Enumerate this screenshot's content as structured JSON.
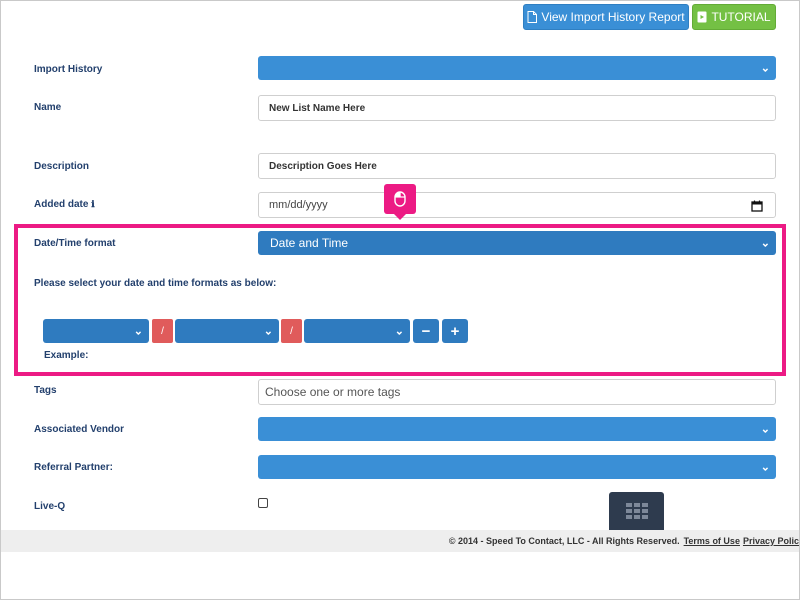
{
  "header": {
    "history_report_label": "View Import History Report",
    "tutorial_label": "TUTORIAL"
  },
  "form": {
    "import_history_label": "Import History",
    "name_label": "Name",
    "name_value": "New List Name Here",
    "description_label": "Description",
    "description_value": "Description Goes Here",
    "added_date_label": "Added date",
    "added_date_info": "ℹ",
    "added_date_placeholder": "mm/dd/yyyy",
    "datetime_label": "Date/Time format",
    "datetime_value": "Date and Time",
    "formats_instruction": "Please select your date and time formats as below:",
    "separator": "/",
    "minus_label": "−",
    "plus_label": "+",
    "example_label": "Example:",
    "tags_label": "Tags",
    "tags_placeholder": "Choose one or more tags",
    "vendor_label": "Associated Vendor",
    "referral_label": "Referral Partner:",
    "liveq_label": "Live-Q"
  },
  "footer": {
    "copyright": "© 2014 - Speed To Contact, LLC - All Rights Reserved.",
    "terms_link": "Terms of Use",
    "privacy_link": "Privacy Polic"
  },
  "icons": {
    "document": "document-icon",
    "tutorial": "video-icon",
    "chevron": "chevron-down-icon",
    "calendar": "calendar-icon",
    "mouse": "mouse-icon",
    "keypad": "keypad-icon",
    "info": "info-icon"
  },
  "colors": {
    "primary": "#3a8fd6",
    "primary_dark": "#2f7bbf",
    "success": "#74c044",
    "separator": "#e05b5b",
    "highlight": "#ec1a84",
    "label": "#23406d"
  }
}
